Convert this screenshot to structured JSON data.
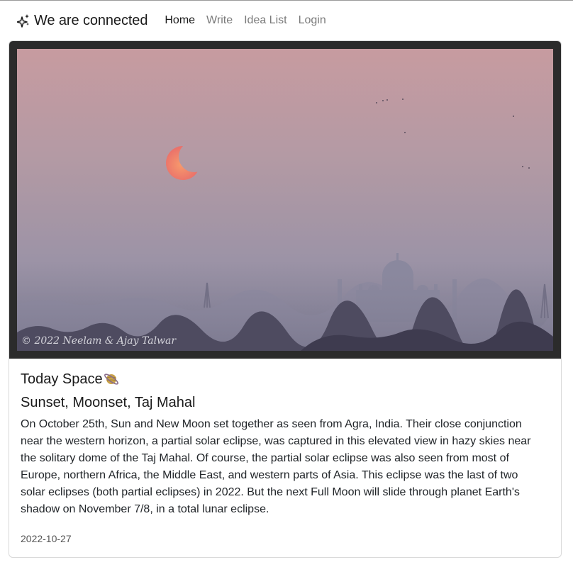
{
  "navbar": {
    "brand_icon": "sparkles-icon",
    "brand_title": "We are connected",
    "links": [
      "Home",
      "Write",
      "Idea List",
      "Login"
    ],
    "active_index": 0
  },
  "card": {
    "photo_credit": "© 2022 Neelam & Ajay Talwar",
    "heading": "Today Space",
    "heading_icon": "ringed-planet-icon",
    "title": "Sunset, Moonset, Taj Mahal",
    "description": "On October 25th, Sun and New Moon set together as seen from Agra, India. Their close conjunction near the western horizon, a partial solar eclipse, was captured in this elevated view in hazy skies near the solitary dome of the Taj Mahal. Of course, the partial solar eclipse was also seen from most of Europe, northern Africa, the Middle East, and western parts of Asia. This eclipse was the last of two solar eclipses (both partial eclipses) in 2022. But the next Full Moon will slide through planet Earth's shadow on November 7/8, in a total lunar eclipse.",
    "date": "2022-10-27"
  },
  "colors": {
    "frame": "#2b2b2b",
    "sky_top": "#c49a9e",
    "sky_bottom": "#8f8aa0",
    "sun": "#f07860",
    "nav_active": "#1a1a1a",
    "nav_inactive": "#7a7a7a"
  }
}
